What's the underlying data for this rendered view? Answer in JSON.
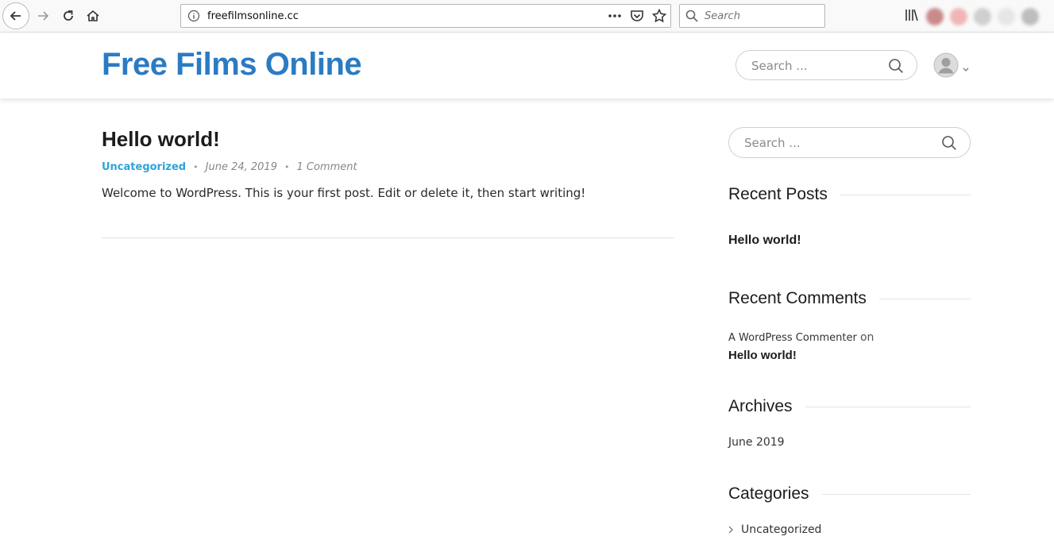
{
  "browser": {
    "url": "freefilmsonline.cc",
    "search_placeholder": "Search"
  },
  "header": {
    "site_title": "Free Films Online",
    "search_placeholder": "Search ..."
  },
  "post": {
    "title": "Hello world!",
    "category": "Uncategorized",
    "date": "June 24, 2019",
    "comments": "1 Comment",
    "separator": "•",
    "body": "Welcome to WordPress. This is your first post. Edit or delete it, then start writing!"
  },
  "sidebar": {
    "search_placeholder": "Search ...",
    "recent_posts": {
      "title": "Recent Posts",
      "items": [
        "Hello world!"
      ]
    },
    "recent_comments": {
      "title": "Recent Comments",
      "author": "A WordPress Commenter",
      "on": "on",
      "post": "Hello world!"
    },
    "archives": {
      "title": "Archives",
      "items": [
        "June 2019"
      ]
    },
    "categories": {
      "title": "Categories",
      "items": [
        "Uncategorized"
      ]
    }
  },
  "colors": {
    "site_title": "#2b7bc3",
    "category_link": "#2ea3d8"
  }
}
